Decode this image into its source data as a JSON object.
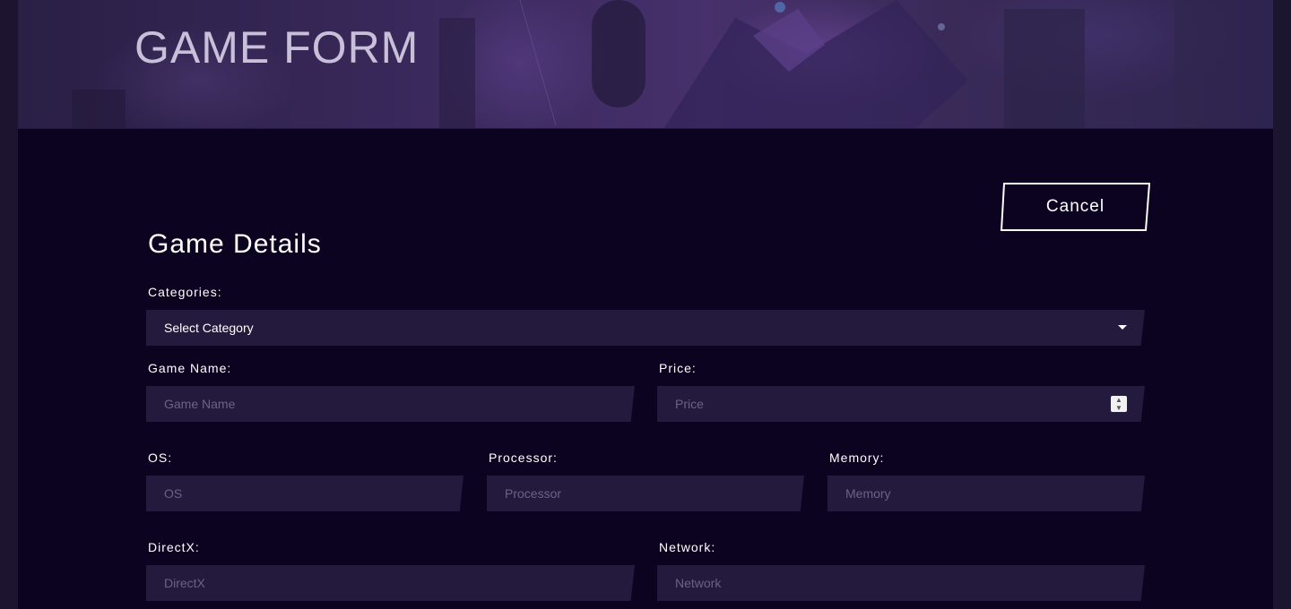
{
  "header": {
    "title": "GAME FORM"
  },
  "actions": {
    "cancel_label": "Cancel"
  },
  "form": {
    "section_title": "Game Details",
    "categories": {
      "label": "Categories:",
      "selected": "Select Category"
    },
    "game_name": {
      "label": "Game Name:",
      "placeholder": "Game Name"
    },
    "price": {
      "label": "Price:",
      "placeholder": "Price"
    },
    "os": {
      "label": "OS:",
      "placeholder": "OS"
    },
    "processor": {
      "label": "Processor:",
      "placeholder": "Processor"
    },
    "memory": {
      "label": "Memory:",
      "placeholder": "Memory"
    },
    "directx": {
      "label": "DirectX:",
      "placeholder": "DirectX"
    },
    "network": {
      "label": "Network:",
      "placeholder": "Network"
    }
  },
  "icons": {
    "select_caret": "chevron-down-icon",
    "price_stepper": "number-stepper-icon"
  },
  "colors": {
    "background": "#0c0320",
    "field_background": "#231a3d",
    "banner_purple": "#47306b",
    "text": "#ffffff",
    "placeholder": "#6b6384"
  }
}
